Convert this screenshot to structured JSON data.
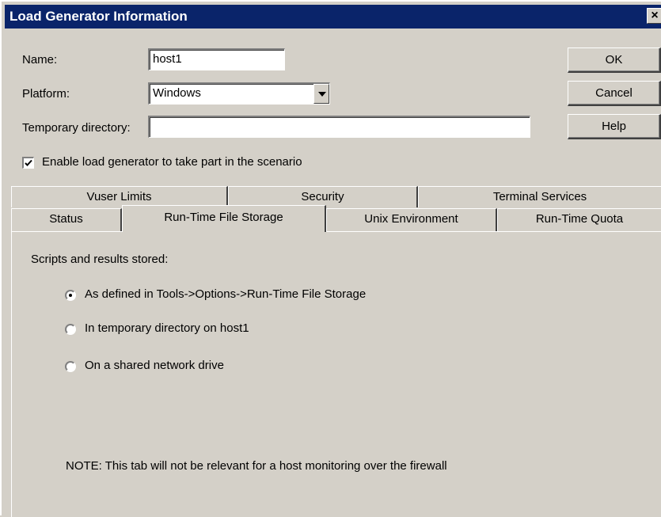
{
  "window": {
    "title": "Load Generator Information",
    "close_label": "×"
  },
  "form": {
    "name_label": "Name:",
    "name_value": "host1",
    "platform_label": "Platform:",
    "platform_value": "Windows",
    "tempdir_label": "Temporary directory:",
    "tempdir_value": "",
    "enable_label": "Enable load generator to take part in the scenario",
    "enable_checked": true
  },
  "buttons": {
    "ok": "OK",
    "cancel": "Cancel",
    "help": "Help"
  },
  "tabs": {
    "back_row": [
      "Vuser Limits",
      "Security",
      "Terminal Services"
    ],
    "front_row": [
      "Status",
      "Run-Time File Storage",
      "Unix Environment",
      "Run-Time Quota"
    ],
    "active": "Run-Time File Storage"
  },
  "panel": {
    "heading": "Scripts and results stored:",
    "options": [
      {
        "label": "As defined in Tools->Options->Run-Time File Storage",
        "selected": true
      },
      {
        "label": "In temporary directory on host1",
        "selected": false
      },
      {
        "label": "On a shared network drive",
        "selected": false
      }
    ],
    "note": "NOTE: This tab will not be relevant for a host monitoring over the firewall"
  }
}
